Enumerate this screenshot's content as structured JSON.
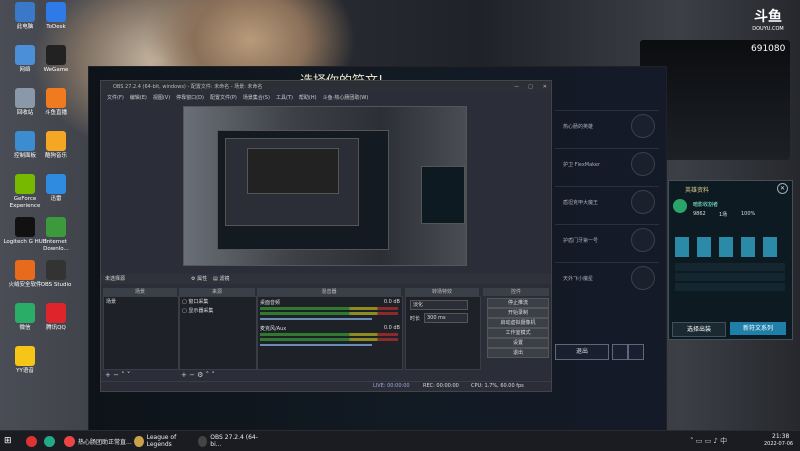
{
  "stream_overlay": {
    "logo": "斗鱼",
    "site": "DOUYU.COM",
    "room_id": "691080"
  },
  "desktop_icons": [
    {
      "label": "此电脑",
      "icon": "computer-icon",
      "color": "#3a78c8"
    },
    {
      "label": "ToDesk",
      "icon": "todesk-icon",
      "color": "#2e7be8"
    },
    {
      "label": "网络",
      "icon": "network-icon",
      "color": "#4a8fd8"
    },
    {
      "label": "WeGame",
      "icon": "wegame-icon",
      "color": "#222"
    },
    {
      "label": "回收站",
      "icon": "recycle-bin-icon",
      "color": "#8a99aa"
    },
    {
      "label": "斗鱼直播",
      "icon": "douyu-icon",
      "color": "#f07a20"
    },
    {
      "label": "控制面板",
      "icon": "control-panel-icon",
      "color": "#3b8cd0"
    },
    {
      "label": "酷狗音乐",
      "icon": "kugou-icon",
      "color": "#f5a623"
    },
    {
      "label": "GeForce Experience",
      "icon": "geforce-icon",
      "color": "#76b900"
    },
    {
      "label": "迅雷",
      "icon": "xunlei-icon",
      "color": "#2f8be0"
    },
    {
      "label": "Logitech G HUB",
      "icon": "logitech-icon",
      "color": "#111"
    },
    {
      "label": "Internet Downlo...",
      "icon": "idm-icon",
      "color": "#3c9a3c"
    },
    {
      "label": "火绒安全软件",
      "icon": "huorong-icon",
      "color": "#e86a1c"
    },
    {
      "label": "OBS Studio",
      "icon": "obs-icon",
      "color": "#333"
    },
    {
      "label": "微信",
      "icon": "wechat-icon",
      "color": "#2aae67"
    },
    {
      "label": "腾讯QQ",
      "icon": "qq-icon",
      "color": "#e0242b"
    },
    {
      "label": "YY语音",
      "icon": "yy-icon",
      "color": "#f5c518"
    }
  ],
  "game": {
    "title": "选择你的符文!",
    "rune_rows": [
      "热心肠的英雄",
      "护卫 FlexMaker",
      "盾坦克甲大魔王",
      "护盾门牙第一号",
      "天外飞小魔星"
    ],
    "exit_button": "退出"
  },
  "obs": {
    "title": "OBS 27.2.4 (64-bit, windows) - 配置文件: 未命名 - 场景: 未命名",
    "menu": [
      "文件(F)",
      "编辑(E)",
      "视图(V)",
      "停靠窗口(D)",
      "配置文件(P)",
      "场景集合(S)",
      "工具(T)",
      "帮助(H)",
      "斗鱼-热心肠团助(W)"
    ],
    "no_source": "未选择源",
    "properties": "属性",
    "filters": "滤镜",
    "docks": {
      "scenes": "场景",
      "sources": "来源",
      "mixer": "混音器",
      "transitions": "转场特效",
      "controls": "控件"
    },
    "scene_items": [
      "场景"
    ],
    "source_items": [
      "窗口采集",
      "显示器采集"
    ],
    "audio": [
      {
        "name": "桌面音频",
        "level": "0.0 dB"
      },
      {
        "name": "麦克风/Aux",
        "level": "0.0 dB"
      }
    ],
    "transition": {
      "type": "淡化",
      "duration_label": "时长",
      "duration": "300 ms"
    },
    "controls": [
      "停止推流",
      "开始录制",
      "启动虚拟摄像机",
      "工作室模式",
      "设置",
      "退出"
    ],
    "status": {
      "live": "LIVE: 00:00:00",
      "rec": "REC: 00:00:00",
      "cpu": "CPU: 1.7%, 60.00 fps"
    }
  },
  "lobby_panel": {
    "header": "英雄资料",
    "hero_name": "暗影收割者",
    "stats": [
      "9862",
      "1场",
      "100%"
    ],
    "select_button": "选择出装",
    "new_skin_button": "新符文系列",
    "colors": {
      "accent": "#1f7fa8",
      "border": "#41505a"
    }
  },
  "taskbar": {
    "apps": [
      "热心肠团助正常直...",
      "League of Legends",
      "OBS 27.2.4 (64-bi..."
    ],
    "time": "21:38",
    "date": "2022-07-06"
  }
}
